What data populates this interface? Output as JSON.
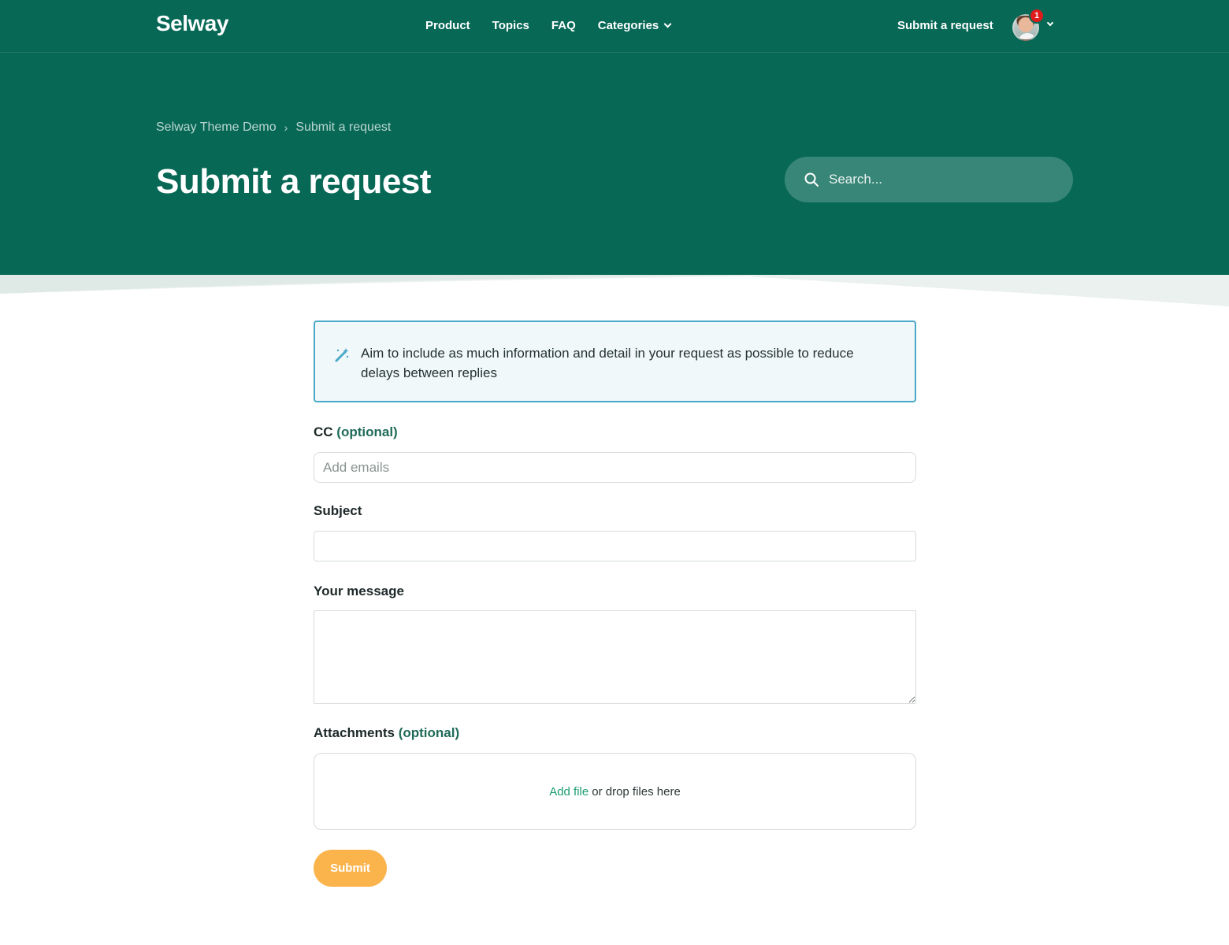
{
  "header": {
    "logo": "Selway",
    "nav": [
      {
        "label": "Product"
      },
      {
        "label": "Topics"
      },
      {
        "label": "FAQ"
      },
      {
        "label": "Categories"
      }
    ],
    "submit_link": "Submit a request",
    "notifications_count": "1"
  },
  "hero": {
    "breadcrumb": [
      "Selway Theme Demo",
      "Submit a request"
    ],
    "breadcrumb_separator": "›",
    "title": "Submit a request",
    "search_placeholder": "Search..."
  },
  "form": {
    "notice": "Aim to include as much information and detail in your request as possible to reduce delays between replies",
    "cc_label": "CC",
    "optional_text": "(optional)",
    "cc_placeholder": "Add emails",
    "subject_label": "Subject",
    "subject_value": "",
    "message_label": "Your message",
    "message_value": "",
    "attachments_label": "Attachments",
    "add_file": "Add file",
    "drop_text": "or drop files here",
    "submit_label": "Submit"
  },
  "colors": {
    "brand": "#076856",
    "accent_button": "#fbb44c",
    "notice_border": "#4aa9c9",
    "link": "#1a9c6f"
  }
}
